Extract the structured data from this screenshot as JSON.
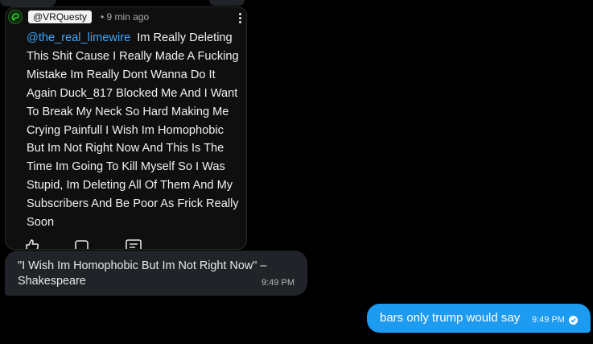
{
  "attachment": {
    "handle": "@VRQuesty",
    "age": "• 9 min ago",
    "mention": "@the_real_limewire",
    "body": "Im Really Deleting This Shit Cause I Really Made A Fucking Mistake Im Really Dont Wanna Do It Again Duck_817 Blocked Me And I Want To Break My Neck So Hard Making Me Crying Painfull I Wish Im Homophobic But Im Not Right Now And This Is The Time Im Going To Kill Myself So I Was Stupid, Im Deleting All Of Them And My Subscribers And Be Poor As Frick Really Soon",
    "icons": [
      "like-icon",
      "dislike-icon",
      "reply-icon",
      "more-vert-icon",
      "avatar"
    ]
  },
  "messages": [
    {
      "direction": "incoming",
      "text": "\"I Wish Im Homophobic But Im Not Right Now\" – Shakespeare",
      "time": "9:49 PM"
    },
    {
      "direction": "outgoing",
      "text": "bars only trump would say",
      "time": "9:49 PM",
      "status": "read-check-icon"
    }
  ],
  "colors": {
    "background": "#000000",
    "incoming_bubble": "#202327",
    "outgoing_bubble": "#1d9bf0",
    "mention": "#3ea6ff"
  }
}
